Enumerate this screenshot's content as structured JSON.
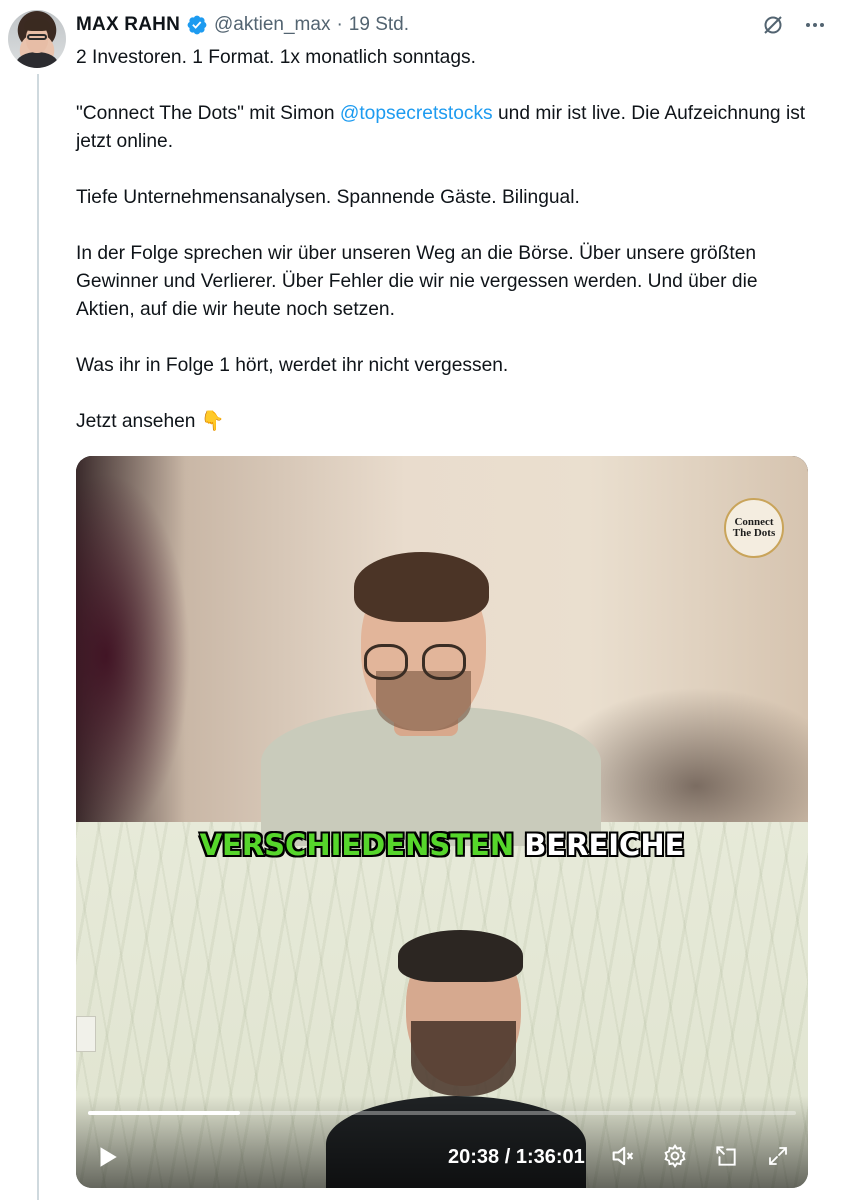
{
  "tweet": {
    "author_name": "MAX RAHN",
    "handle": "@aktien_max",
    "separator": "·",
    "time": "19 Std.",
    "icons": [
      "grok-icon",
      "more-icon"
    ],
    "paragraphs": {
      "p1": "2 Investoren. 1 Format. 1x monatlich sonntags.",
      "p2_before": "\"Connect The Dots\" mit Simon ",
      "p2_mention": "@topsecretstocks",
      "p2_after": " und mir ist live. Die Aufzeichnung ist jetzt online.",
      "p3": "Tiefe Unternehmensanalysen. Spannende Gäste. Bilingual.",
      "p4": "In der Folge sprechen wir über unseren Weg an die Börse. Über unsere größten Gewinner und Verlierer. Über Fehler die wir nie vergessen werden. Und über die Aktien, auf die wir heute noch setzen.",
      "p5": "Was ihr in Folge 1 hört, werdet ihr nicht vergessen.",
      "p6": "Jetzt ansehen 👇"
    }
  },
  "video": {
    "logo_line1": "Connect",
    "logo_line2": "The Dots",
    "caption_green": "VERSCHIEDENSTEN",
    "caption_white": "BEREICHE",
    "time_readout": "20:38 / 1:36:01",
    "progress_fraction": 0.2148,
    "controls": [
      "play-icon",
      "volume-icon",
      "settings-icon",
      "pip-icon",
      "fullscreen-icon"
    ]
  },
  "colors": {
    "mention": "#1d9bf0",
    "verified": "#1d9bf0",
    "caption_green": "#56d62b",
    "muted": "#536471"
  }
}
